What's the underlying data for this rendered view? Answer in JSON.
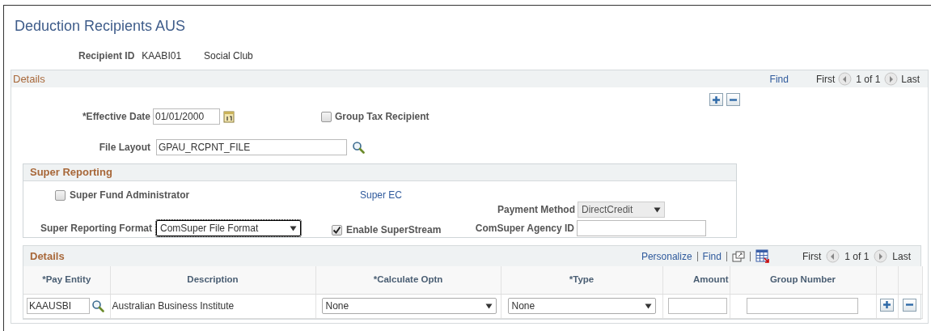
{
  "page_title": "Deduction Recipients AUS",
  "recipient": {
    "label": "Recipient ID",
    "id": "KAABI01",
    "name": "Social Club"
  },
  "details_panel": {
    "title": "Details",
    "find": "Find",
    "first": "First",
    "position": "1 of 1",
    "last": "Last"
  },
  "effective_date": {
    "label": "*Effective Date",
    "value": "01/01/2000"
  },
  "group_tax_recipient": {
    "label": "Group Tax Recipient",
    "checked": false
  },
  "file_layout": {
    "label": "File Layout",
    "value": "GPAU_RCPNT_FILE"
  },
  "super_reporting": {
    "title": "Super Reporting",
    "super_fund_administrator": {
      "label": "Super Fund Administrator",
      "checked": false
    },
    "super_ec_link": "Super EC",
    "payment_method": {
      "label": "Payment Method",
      "value": "DirectCredit",
      "disabled": true
    },
    "format": {
      "label": "Super Reporting Format",
      "value": "ComSuper File Format",
      "focused": true
    },
    "enable_superstream": {
      "label": "Enable SuperStream",
      "checked": true
    },
    "agency_id": {
      "label": "ComSuper Agency ID"
    }
  },
  "grid": {
    "title": "Details",
    "personalize": "Personalize",
    "find": "Find",
    "first": "First",
    "position": "1 of 1",
    "last": "Last",
    "columns": [
      "*Pay Entity",
      "Description",
      "*Calculate Optn",
      "*Type",
      "Amount",
      "Group Number"
    ],
    "rows": [
      {
        "pay_entity": "KAAUSBI",
        "description": "Australian Business Institute",
        "calculate_optn": "None",
        "type": "None"
      }
    ]
  }
}
